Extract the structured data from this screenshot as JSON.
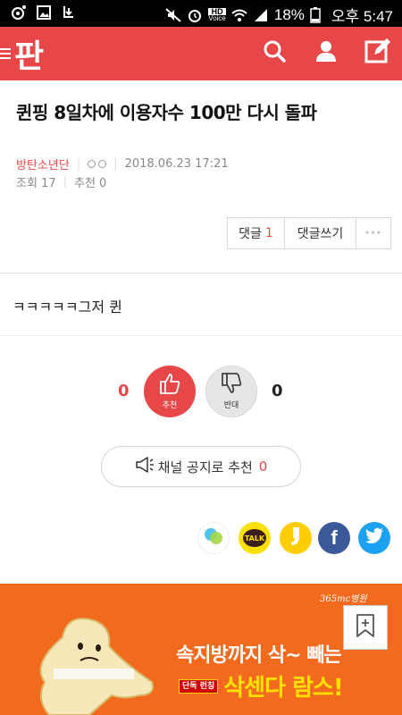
{
  "status_bar": {
    "battery_percent": "18%",
    "time": "오후 5:47",
    "hd_label": "HD",
    "voice_label": "Voice"
  },
  "app_bar": {
    "logo_text": "판",
    "brand_color": "#e8474a"
  },
  "article": {
    "title": "퀸핑 8일차에 이용자수 100만 다시 돌파",
    "author": "방탄소년단",
    "datetime": "2018.06.23 17:21",
    "views_label": "조회 17",
    "recommends_label": "추천 0",
    "body": "ㅋㅋㅋㅋㅋ그저 퀸"
  },
  "comment_bar": {
    "comments_label": "댓글",
    "comments_count": "1",
    "write_label": "댓글쓰기",
    "more_label": "···"
  },
  "votes": {
    "up_count": "0",
    "up_label": "추천",
    "down_count": "0",
    "down_label": "반대"
  },
  "notice": {
    "label": "채널 공지로 추천",
    "count": "0"
  },
  "share": {
    "kakaotalk_label": "TALK",
    "facebook_label": "f"
  },
  "ad": {
    "brand": "365mc병원",
    "line1": "속지방까지 삭~ 빼는",
    "badge": "단독 런칭",
    "line2": "삭센다 람스!"
  }
}
